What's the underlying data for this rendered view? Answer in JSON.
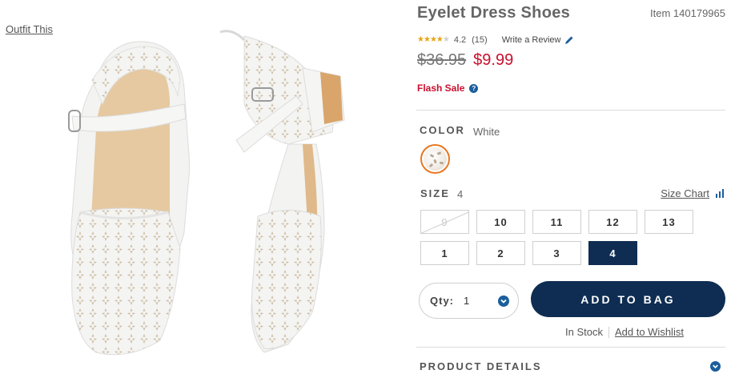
{
  "outfit_link": "Outfit This",
  "product": {
    "title": "Eyelet Dress Shoes",
    "item_number": "Item 140179965",
    "rating": "4.2",
    "rating_fraction": 0.84,
    "review_count": "(15)",
    "write_review": "Write a Review",
    "old_price": "$36.95",
    "sale_price": "$9.99",
    "flash_sale": "Flash Sale",
    "help_glyph": "?"
  },
  "color": {
    "label": "COLOR",
    "selected": "White",
    "swatch_icon": "white-eyelet-swatch"
  },
  "size": {
    "label": "SIZE",
    "selected": "4",
    "size_chart": "Size Chart",
    "options": [
      {
        "label": "9",
        "available": false
      },
      {
        "label": "10",
        "available": true
      },
      {
        "label": "11",
        "available": true
      },
      {
        "label": "12",
        "available": true
      },
      {
        "label": "13",
        "available": true
      },
      {
        "label": "1",
        "available": true
      },
      {
        "label": "2",
        "available": true
      },
      {
        "label": "3",
        "available": true
      },
      {
        "label": "4",
        "available": true,
        "selected": true
      }
    ]
  },
  "quantity": {
    "label": "Qty:",
    "value": "1"
  },
  "add_to_bag": "ADD TO BAG",
  "stock_status": "In Stock",
  "wishlist": "Add to Wishlist",
  "product_details": "PRODUCT DETAILS",
  "colors": {
    "navy": "#0f2d52",
    "sale_red": "#c8102e",
    "accent_blue": "#1b5e9c",
    "swatch_ring": "#e87722",
    "star": "#e8a317"
  }
}
